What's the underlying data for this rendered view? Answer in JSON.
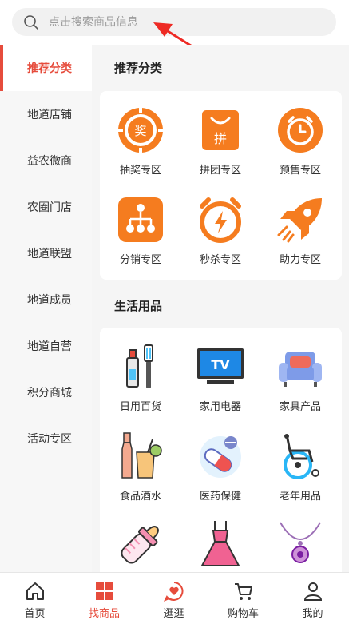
{
  "search": {
    "placeholder": "点击搜索商品信息"
  },
  "sidebar": {
    "items": [
      {
        "label": "推荐分类",
        "active": true
      },
      {
        "label": "地道店铺"
      },
      {
        "label": "益农微商"
      },
      {
        "label": "农圈门店"
      },
      {
        "label": "地道联盟"
      },
      {
        "label": "地道成员"
      },
      {
        "label": "地道自营"
      },
      {
        "label": "积分商城"
      },
      {
        "label": "活动专区"
      }
    ]
  },
  "sections": [
    {
      "title": "推荐分类",
      "items": [
        {
          "label": "抽奖专区",
          "icon": "lottery-icon"
        },
        {
          "label": "拼团专区",
          "icon": "group-buy-icon"
        },
        {
          "label": "预售专区",
          "icon": "presale-clock-icon"
        },
        {
          "label": "分销专区",
          "icon": "distribution-icon"
        },
        {
          "label": "秒杀专区",
          "icon": "flash-sale-icon"
        },
        {
          "label": "助力专区",
          "icon": "rocket-icon"
        }
      ]
    },
    {
      "title": "生活用品",
      "items": [
        {
          "label": "日用百货",
          "icon": "toothpaste-icon"
        },
        {
          "label": "家用电器",
          "icon": "tv-icon"
        },
        {
          "label": "家具产品",
          "icon": "sofa-icon"
        },
        {
          "label": "食品酒水",
          "icon": "drinks-icon"
        },
        {
          "label": "医药保健",
          "icon": "medicine-icon"
        },
        {
          "label": "老年用品",
          "icon": "wheelchair-icon"
        },
        {
          "label": "",
          "icon": "baby-bottle-icon"
        },
        {
          "label": "",
          "icon": "dress-icon"
        },
        {
          "label": "",
          "icon": "necklace-icon"
        }
      ]
    }
  ],
  "tabbar": {
    "items": [
      {
        "label": "首页",
        "icon": "home-icon"
      },
      {
        "label": "找商品",
        "icon": "category-grid-icon",
        "active": true
      },
      {
        "label": "逛逛",
        "icon": "heart-chat-icon"
      },
      {
        "label": "购物车",
        "icon": "cart-icon"
      },
      {
        "label": "我的",
        "icon": "user-icon"
      }
    ]
  },
  "colors": {
    "accent": "#e64c3c",
    "orange": "#f57c1f",
    "blue": "#2196f3"
  }
}
